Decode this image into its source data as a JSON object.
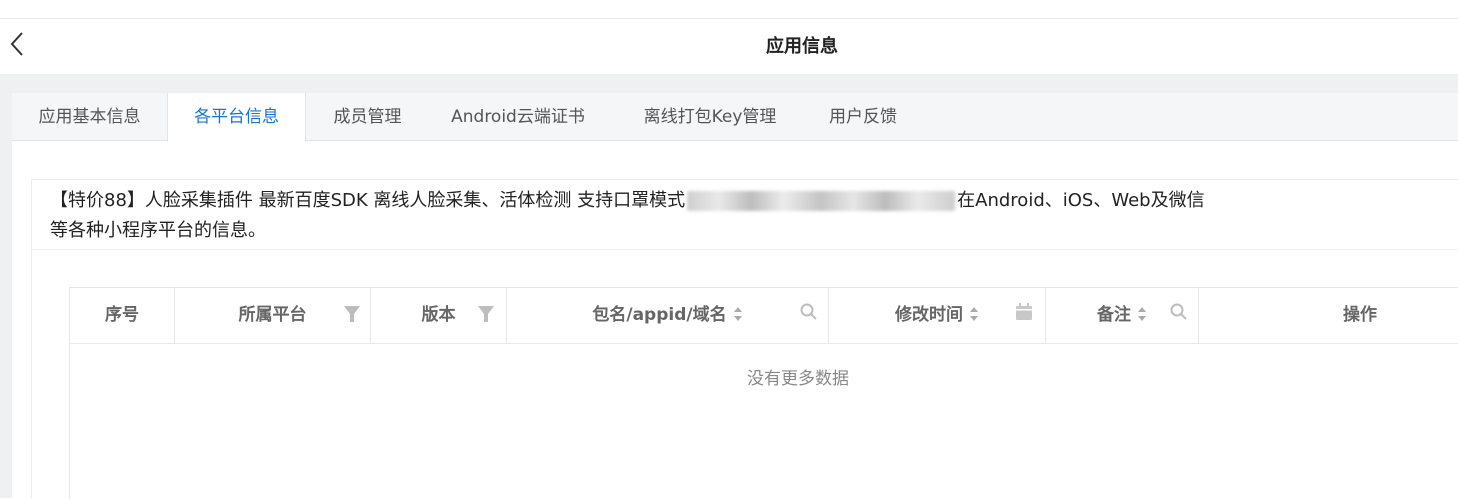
{
  "header": {
    "title": "应用信息"
  },
  "tabs": [
    {
      "label": "应用基本信息",
      "active": false
    },
    {
      "label": "各平台信息",
      "active": true
    },
    {
      "label": "成员管理",
      "active": false
    },
    {
      "label": "Android云端证书",
      "active": false
    },
    {
      "label": "离线打包Key管理",
      "active": false
    },
    {
      "label": "用户反馈",
      "active": false
    }
  ],
  "card": {
    "desc_before": "【特价88】人脸采集插件 最新百度SDK 离线人脸采集、活体检测 支持口罩模式",
    "desc_after": "在Android、iOS、Web及微信等各种小程序平台的信息。"
  },
  "table": {
    "columns": [
      {
        "label": "序号"
      },
      {
        "label": "所属平台",
        "icon": "filter-icon"
      },
      {
        "label": "版本",
        "icon": "filter-icon"
      },
      {
        "label": "包名/appid/域名",
        "sortable": true,
        "icon": "search-icon"
      },
      {
        "label": "修改时间",
        "sortable": true,
        "icon": "calendar-icon"
      },
      {
        "label": "备注",
        "sortable": true,
        "icon": "search-icon"
      },
      {
        "label": "操作"
      }
    ],
    "empty_text": "没有更多数据"
  },
  "colors": {
    "accent": "#1677d4",
    "background": "#eff0f2"
  }
}
